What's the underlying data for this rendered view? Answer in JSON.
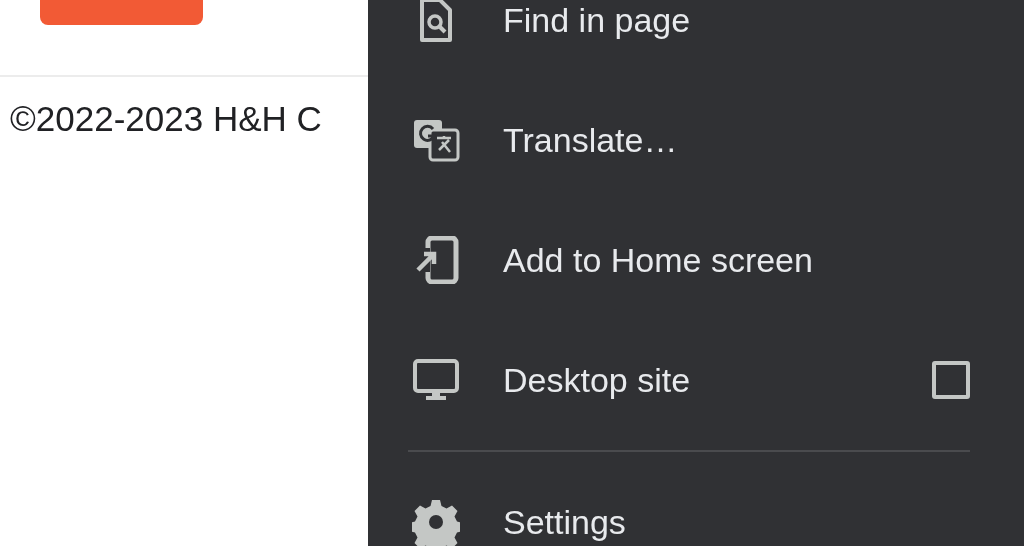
{
  "page": {
    "footer": "©2022-2023 H&H C"
  },
  "menu": {
    "items": [
      {
        "kind": "action",
        "label": "Find in page"
      },
      {
        "kind": "action",
        "label": "Translate…"
      },
      {
        "kind": "action",
        "label": "Add to Home screen"
      },
      {
        "kind": "toggle",
        "label": "Desktop site",
        "checked": false
      },
      {
        "kind": "divider"
      },
      {
        "kind": "action",
        "label": "Settings"
      }
    ]
  }
}
